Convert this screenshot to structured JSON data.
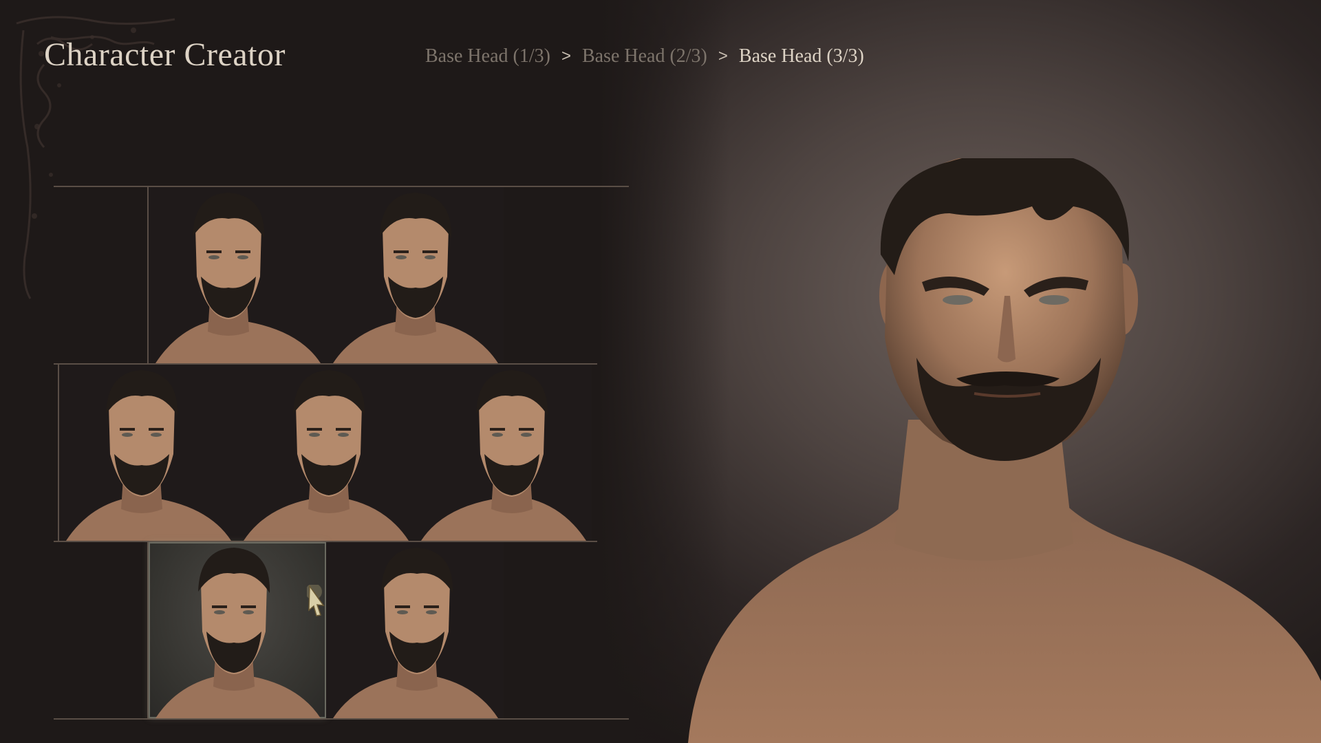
{
  "header": {
    "title": "Character Creator"
  },
  "breadcrumb": {
    "items": [
      {
        "label": "Base Head (1/3)",
        "current": false
      },
      {
        "label": "Base Head (2/3)",
        "current": false
      },
      {
        "label": "Base Head (3/3)",
        "current": true
      }
    ],
    "separator": ">"
  },
  "head_grid": {
    "rows": [
      {
        "tiles": [
          {
            "id": "head-1",
            "selected": false
          },
          {
            "id": "head-2",
            "selected": false
          }
        ]
      },
      {
        "tiles": [
          {
            "id": "head-3",
            "selected": false
          },
          {
            "id": "head-4",
            "selected": false
          },
          {
            "id": "head-5",
            "selected": false
          }
        ]
      },
      {
        "tiles": [
          {
            "id": "head-6",
            "selected": true
          },
          {
            "id": "head-7",
            "selected": false
          }
        ]
      }
    ]
  },
  "colors": {
    "title": "#ddd3c5",
    "breadcrumb_inactive": "#7d746b",
    "grid_line": "#5a4e46",
    "selected_tile": "#3a3935",
    "skin": "#b48a6c",
    "hair": "#221c18"
  },
  "icons": {
    "cursor": "gauntlet-pointer-icon"
  }
}
